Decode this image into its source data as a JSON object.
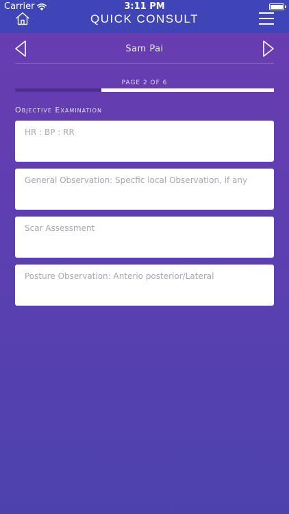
{
  "status_bar": {
    "carrier": "Carrier",
    "time": "3:11 PM"
  },
  "header": {
    "title": "QUICK CONSULT",
    "home_icon": "home-icon",
    "menu_icon": "hamburger-menu-icon"
  },
  "patient_nav": {
    "name": "Sam Pai",
    "prev_icon": "triangle-left-icon",
    "next_icon": "triangle-right-icon"
  },
  "progress": {
    "label": "PAGE 2 OF 6",
    "current_page": 2,
    "total_pages": 6,
    "fraction": 0.333
  },
  "section": {
    "heading": "Objective Examination",
    "fields": [
      {
        "placeholder": "HR : BP : RR",
        "value": ""
      },
      {
        "placeholder": "General Observation: Specfic local Observation, if any",
        "value": ""
      },
      {
        "placeholder": "Scar Assessment",
        "value": ""
      },
      {
        "placeholder": "Posture Observation: Anterio posterior/Lateral",
        "value": ""
      }
    ]
  },
  "colors": {
    "header_bg": "#3f45b6",
    "background_top": "#6b3cb1",
    "background_bottom": "#4d42ad",
    "progress_fill": "#4e2e8e",
    "progress_track": "#ffffff",
    "field_bg": "#ffffff",
    "placeholder_text": "#a8a8b2"
  }
}
